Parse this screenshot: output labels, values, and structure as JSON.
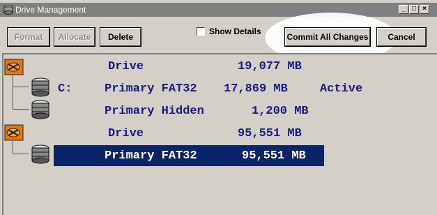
{
  "window": {
    "title": "Drive Management",
    "controls": {
      "minimize": "_",
      "maximize": "□",
      "close": "×"
    }
  },
  "toolbar": {
    "format_label": "Format",
    "allocate_label": "Allocate",
    "delete_label": "Delete",
    "show_details_label": "Show Details",
    "show_details_checked": false,
    "commit_label": "Commit All Changes",
    "cancel_label": "Cancel"
  },
  "tree": {
    "rows": [
      {
        "letter": "",
        "type": "Drive",
        "size": "19,077 MB",
        "flag": ""
      },
      {
        "letter": "C:",
        "type": "Primary FAT32",
        "size": "17,869 MB",
        "flag": "Active"
      },
      {
        "letter": "",
        "type": "Primary Hidden",
        "size": "1,200 MB",
        "flag": ""
      },
      {
        "letter": "",
        "type": "Drive",
        "size": "95,551 MB",
        "flag": ""
      },
      {
        "letter": "",
        "type": "Primary FAT32",
        "size": "95,551 MB",
        "flag": "",
        "selected": true
      }
    ]
  },
  "colors": {
    "text_blue": "#1a1a80",
    "selection": "#0a246a",
    "face": "#d4d0c8",
    "titlebar": "#808080"
  }
}
